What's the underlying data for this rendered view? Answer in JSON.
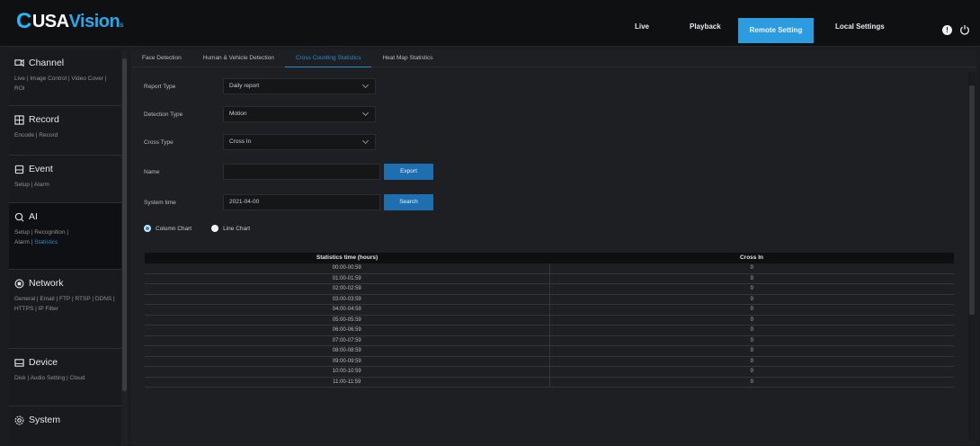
{
  "brand": {
    "c": "C",
    "usa": "USA",
    "vision": "Vision",
    "tm": "S"
  },
  "topnav": {
    "live": "Live",
    "playback": "Playback",
    "remote": "Remote Setting",
    "local": "Local Settings"
  },
  "sidebar": [
    {
      "label": "Channel",
      "icon": "channel-icon",
      "sub": "Live | Image Control | Video Cover | ROI"
    },
    {
      "label": "Record",
      "icon": "record-icon",
      "sub": "Encode | Record"
    },
    {
      "label": "Event",
      "icon": "event-icon",
      "sub": "Setup | Alarm"
    },
    {
      "label": "AI",
      "icon": "ai-icon",
      "sub": "Setup | Recognition |",
      "sub2": "Alarm | ",
      "sub2_hl": "Statistics"
    },
    {
      "label": "Network",
      "icon": "network-icon",
      "sub": "General | Email | FTP | RTSP | DDNS | HTTPS | IP Filter"
    },
    {
      "label": "Device",
      "icon": "device-icon",
      "sub": "Disk | Audio Setting | Cloud"
    },
    {
      "label": "System",
      "icon": "system-icon",
      "sub": ""
    }
  ],
  "tabs": [
    "Face Detection",
    "Human & Vehicle Detection",
    "Cross Counting Statistics",
    "Heat Map Statistics"
  ],
  "form": {
    "report_type_label": "Report Type",
    "report_type_value": "Daily report",
    "detection_type_label": "Detection Type",
    "detection_type_value": "Motion",
    "cross_type_label": "Cross Type",
    "cross_type_value": "Cross In",
    "name_label": "Name",
    "name_value": "",
    "export_label": "Export",
    "system_time_label": "System time",
    "system_time_value": "2021-04-00",
    "search_label": "Search"
  },
  "chart_options": {
    "column": "Column Chart",
    "line": "Line Chart"
  },
  "table": {
    "headers": [
      "Statistics time (hours)",
      "Cross In"
    ],
    "rows": [
      [
        "00:00-00:59",
        "0"
      ],
      [
        "01:00-01:59",
        "0"
      ],
      [
        "02:00-02:59",
        "0"
      ],
      [
        "03:00-03:59",
        "0"
      ],
      [
        "04:00-04:59",
        "0"
      ],
      [
        "05:00-05:59",
        "0"
      ],
      [
        "06:00-06:59",
        "0"
      ],
      [
        "07:00-07:59",
        "0"
      ],
      [
        "08:00-08:59",
        "0"
      ],
      [
        "09:00-09:59",
        "0"
      ],
      [
        "10:00-10:59",
        "0"
      ],
      [
        "11:00-11:59",
        "0"
      ]
    ]
  },
  "colors": {
    "accent": "#2c9be0",
    "button": "#1f6fb0",
    "bg": "#1b1c1f"
  }
}
